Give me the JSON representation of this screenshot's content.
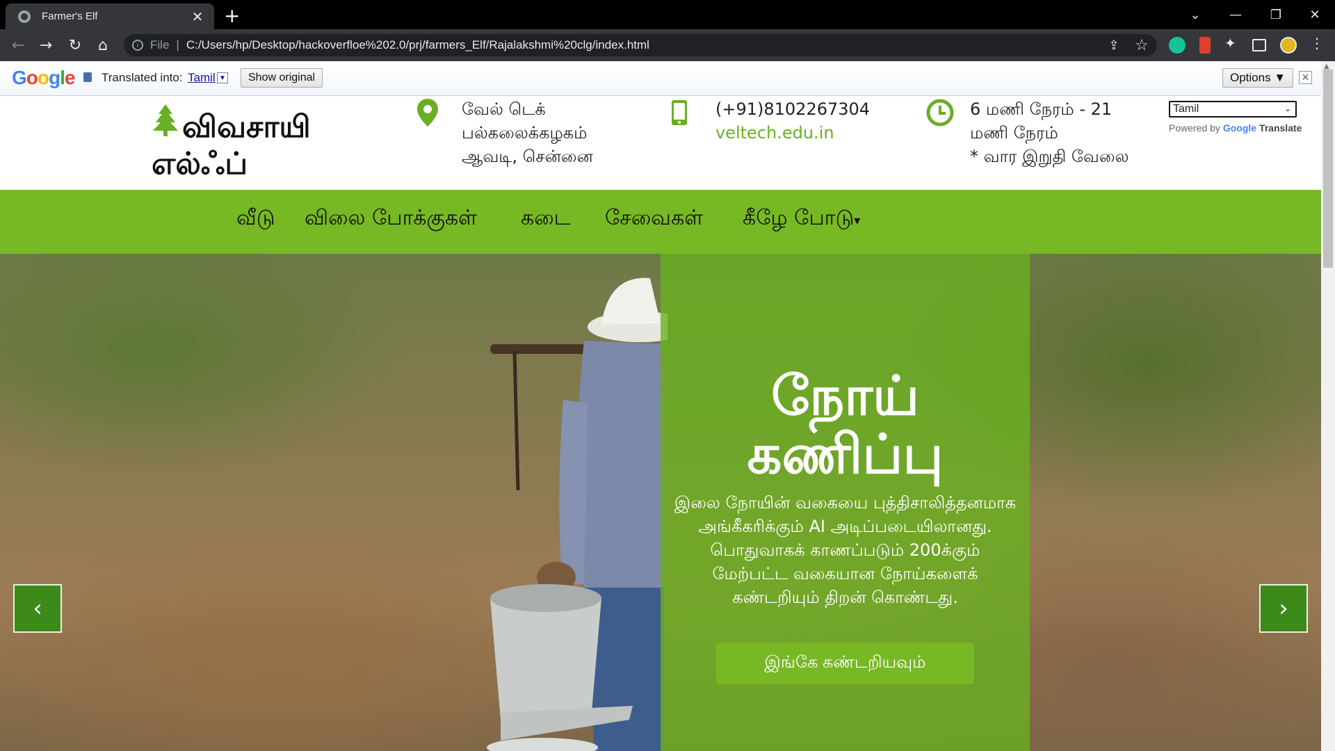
{
  "browser": {
    "tab_title": "Farmer's Elf",
    "tab_close": "✕",
    "new_tab": "+",
    "url_scheme_label": "File",
    "url": "C:/Users/hp/Desktop/hackoverfloe%202.0/prj/farmers_Elf/Rajalakshmi%20clg/index.html"
  },
  "translate_bar": {
    "logo": "Google",
    "translated_into_label": "Translated into:",
    "language": "Tamil",
    "show_original": "Show original",
    "options": "Options ▼",
    "close": "✕"
  },
  "header": {
    "brand_line1": "விவசாயி",
    "brand_line2": "எல்ஃப்",
    "address": [
      "வேல் டெக்",
      "பல்கலைக்கழகம்",
      "ஆவடி, சென்னை"
    ],
    "phone": "(+91)8102267304",
    "website": "veltech.edu.in",
    "hours": [
      "6 மணி நேரம் - 21",
      "மணி நேரம்",
      "* வார இறுதி வேலை"
    ],
    "language_select": "Tamil",
    "powered_by": "Powered by",
    "powered_google": "Google",
    "powered_translate": "Translate"
  },
  "nav": {
    "items": [
      "வீடு",
      "விலை போக்குகள்",
      "கடை",
      "சேவைகள்",
      "கீழே போடு"
    ],
    "dropdown_caret": "▾"
  },
  "hero": {
    "title_line1": "நோய்",
    "title_line2": "கணிப்பு",
    "description": "இலை நோயின் வகையை புத்திசாலித்தனமாக அங்கீகரிக்கும் AI அடிப்படையிலானது. பொதுவாகக் காணப்படும் 200க்கும் மேற்பட்ட வகையான நோய்களைக் கண்டறியும் திறன் கொண்டது.",
    "cta": "இங்கே கண்டறியவும்",
    "prev": "‹",
    "next": "›"
  },
  "colors": {
    "brand_green": "#77b825",
    "overlay_green": "#68b21e",
    "arrow_green": "#3c8a1a"
  }
}
